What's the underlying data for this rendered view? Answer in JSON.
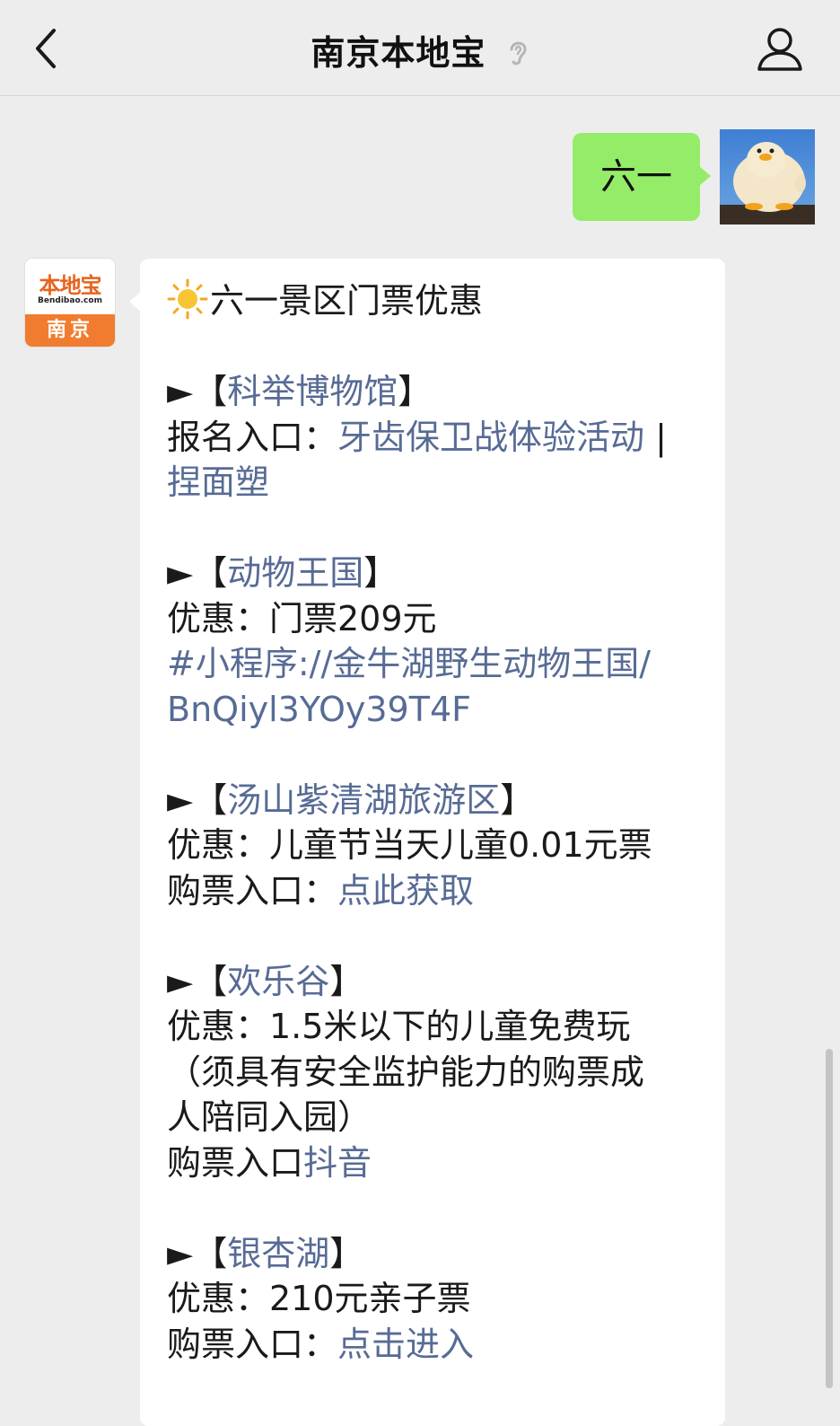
{
  "header": {
    "title": "南京本地宝"
  },
  "outgoing_message": {
    "text": "六一"
  },
  "bot_avatar": {
    "logo_text": "本地宝",
    "logo_sub": "Bendibao.com",
    "city": "南京"
  },
  "incoming_message": {
    "heading": "六一景区门票优惠",
    "sections": [
      {
        "arrow": "►",
        "bracket_open": "【",
        "name": "科举博物馆",
        "bracket_close": "】",
        "lines": [
          {
            "label": "报名入口：",
            "link": "牙齿保卫战体验活动",
            "suffix": " |"
          },
          {
            "label": "",
            "link": " 捏面塑",
            "suffix": ""
          }
        ]
      },
      {
        "arrow": "►",
        "bracket_open": "【",
        "name": "动物王国",
        "bracket_close": "】",
        "lines": [
          {
            "label": "优惠：门票209元",
            "link": "",
            "suffix": ""
          },
          {
            "label": "",
            "link": "#小程序://金牛湖野生动物王国/",
            "suffix": ""
          },
          {
            "label": "",
            "link": "BnQiyl3YOy39T4F",
            "suffix": ""
          }
        ]
      },
      {
        "arrow": "►",
        "bracket_open": "【",
        "name": "汤山紫清湖旅游区",
        "bracket_close": "】",
        "lines": [
          {
            "label": "优惠：儿童节当天儿童0.01元票",
            "link": "",
            "suffix": ""
          },
          {
            "label": "购票入口：",
            "link": "点此获取",
            "suffix": ""
          }
        ]
      },
      {
        "arrow": "►",
        "bracket_open": "【",
        "name": "欢乐谷",
        "bracket_close": "】",
        "lines": [
          {
            "label": "优惠：1.5米以下的儿童免费玩",
            "link": "",
            "suffix": ""
          },
          {
            "label": "（须具有安全监护能力的购票成",
            "link": "",
            "suffix": ""
          },
          {
            "label": "人陪同入园）",
            "link": "",
            "suffix": ""
          },
          {
            "label": "购票入口",
            "link": "抖音",
            "suffix": ""
          }
        ]
      },
      {
        "arrow": "►",
        "bracket_open": "【",
        "name": "银杏湖",
        "bracket_close": "】",
        "lines": [
          {
            "label": "优惠：210元亲子票",
            "link": "",
            "suffix": ""
          },
          {
            "label": "购票入口：",
            "link": "点击进入",
            "suffix": ""
          }
        ]
      }
    ]
  },
  "colors": {
    "background": "#ededed",
    "outgoing_bubble": "#95ec69",
    "incoming_bubble": "#ffffff",
    "link": "#576b95",
    "brand_orange": "#f17c2f"
  }
}
